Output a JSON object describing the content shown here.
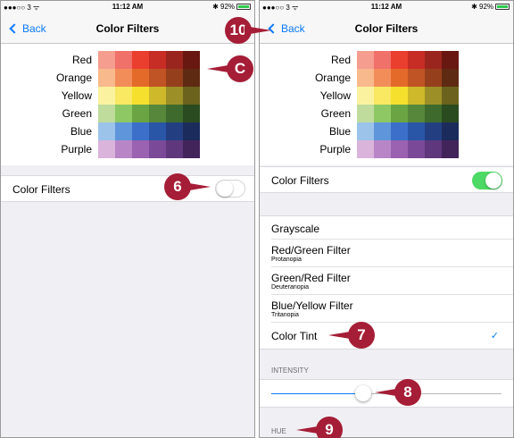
{
  "status_bar": {
    "carrier": "●●●○○ 3 ᯤ",
    "time": "11:12 AM",
    "battery": "✱ 92%",
    "battery_level": 0.92
  },
  "nav": {
    "back_label": "Back",
    "title": "Color Filters"
  },
  "swatch_rows": [
    {
      "label": "Red",
      "colors": [
        "#f59d8f",
        "#f0706a",
        "#ea3e2f",
        "#c72c25",
        "#9a251e",
        "#681810"
      ]
    },
    {
      "label": "Orange",
      "colors": [
        "#f8b98c",
        "#f28d5a",
        "#e46a2a",
        "#c05424",
        "#963f1c",
        "#5f2a12"
      ]
    },
    {
      "label": "Yellow",
      "colors": [
        "#fbf2a0",
        "#f8e862",
        "#f5e02e",
        "#cdb92a",
        "#9c8f27",
        "#6b621d"
      ]
    },
    {
      "label": "Green",
      "colors": [
        "#bfdc9c",
        "#8ec865",
        "#6ba443",
        "#56873a",
        "#3e6a2d",
        "#2a4b1f"
      ]
    },
    {
      "label": "Blue",
      "colors": [
        "#9cc3ea",
        "#5f95da",
        "#3b6fc9",
        "#2a56a8",
        "#233f82",
        "#1b2b5c"
      ]
    },
    {
      "label": "Purple",
      "colors": [
        "#dab4db",
        "#b886c7",
        "#9a62b0",
        "#7a4a98",
        "#5e377c",
        "#42245a"
      ]
    }
  ],
  "left": {
    "color_filters_label": "Color Filters",
    "color_filters_on": false
  },
  "right": {
    "color_filters_label": "Color Filters",
    "color_filters_on": true,
    "filters": [
      {
        "name": "Grayscale",
        "sub": "",
        "checked": false
      },
      {
        "name": "Red/Green Filter",
        "sub": "Protanopia",
        "checked": false
      },
      {
        "name": "Green/Red Filter",
        "sub": "Deuteranopia",
        "checked": false
      },
      {
        "name": "Blue/Yellow Filter",
        "sub": "Tritanopia",
        "checked": false
      },
      {
        "name": "Color Tint",
        "sub": "",
        "checked": true
      }
    ],
    "checkmark": "✓",
    "intensity_header": "INTENSITY",
    "intensity_value": 0.4,
    "hue_header": "HUE"
  },
  "callouts": {
    "c": "C",
    "six": "6",
    "seven": "7",
    "eight": "8",
    "nine": "9",
    "ten": "10"
  },
  "colors": {
    "accent": "#0a7aff",
    "toggle_on": "#4cd964",
    "callout": "#a51d36",
    "background": "#efeff4"
  }
}
